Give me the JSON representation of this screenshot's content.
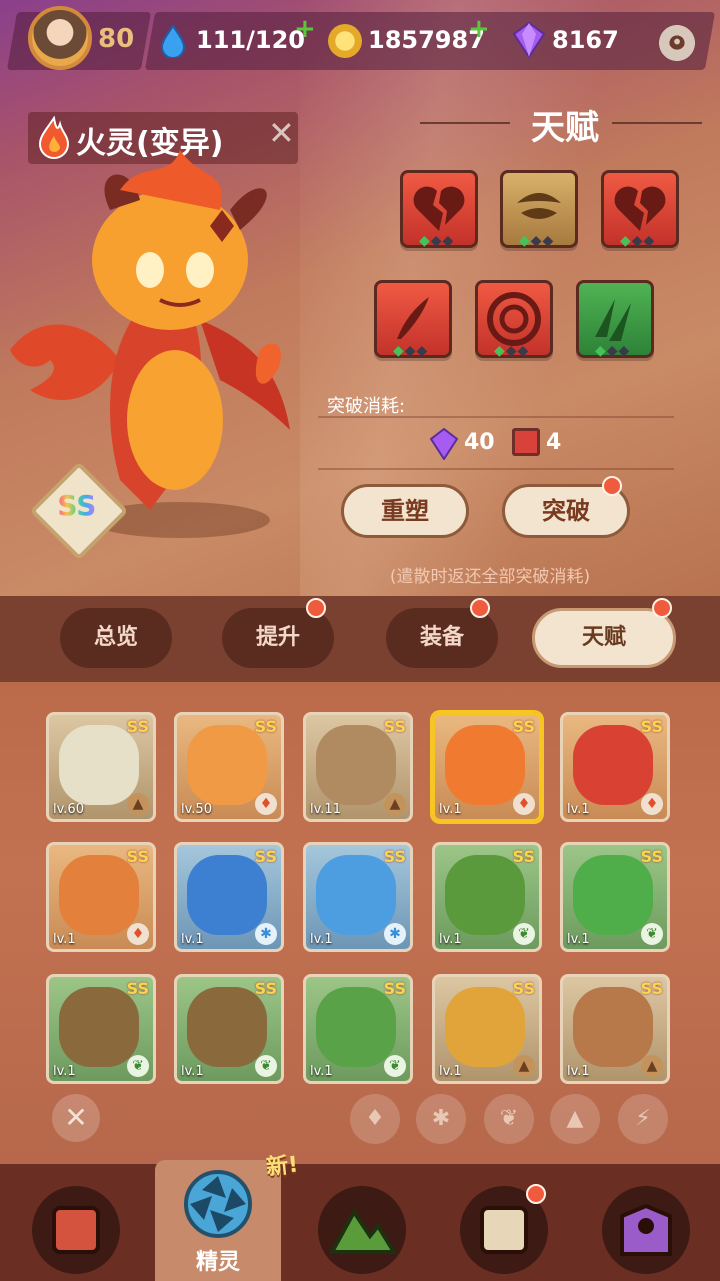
{
  "player": {
    "level": "80"
  },
  "resources": {
    "stamina": "111/120",
    "coins": "1857987",
    "gems": "8167"
  },
  "pet": {
    "name": "火灵(变异)",
    "rank": "SS"
  },
  "talent": {
    "title": "天赋",
    "cost_label": "突破消耗:",
    "cost_gem": "40",
    "cost_book": "4",
    "reshape_label": "重塑",
    "breakthrough_label": "突破",
    "note": "(遣散时返还全部突破消耗)"
  },
  "tabs": [
    {
      "label": "总览"
    },
    {
      "label": "提升"
    },
    {
      "label": "装备"
    },
    {
      "label": "天赋"
    }
  ],
  "pets": [
    {
      "lv": "lv.60",
      "rank": "SS"
    },
    {
      "lv": "lv.50",
      "rank": "SS"
    },
    {
      "lv": "lv.11",
      "rank": "SS"
    },
    {
      "lv": "lv.1",
      "rank": "SS"
    },
    {
      "lv": "lv.1",
      "rank": "SS"
    },
    {
      "lv": "lv.1",
      "rank": "SS"
    },
    {
      "lv": "lv.1",
      "rank": "SS"
    },
    {
      "lv": "lv.1",
      "rank": "SS"
    },
    {
      "lv": "lv.1",
      "rank": "SS"
    },
    {
      "lv": "lv.1",
      "rank": "SS"
    },
    {
      "lv": "lv.1",
      "rank": "SS"
    },
    {
      "lv": "lv.1",
      "rank": "SS"
    },
    {
      "lv": "lv.1",
      "rank": "SS"
    },
    {
      "lv": "lv.1",
      "rank": "SS"
    },
    {
      "lv": "lv.1",
      "rank": "SS"
    }
  ],
  "nav": {
    "active_label": "精灵",
    "new_badge": "新!"
  }
}
